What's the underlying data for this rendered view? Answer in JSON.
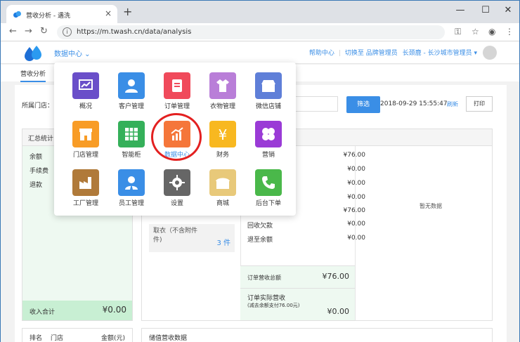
{
  "browser": {
    "tab_title": "营收分析 - 遇洗",
    "new_tab": "+",
    "close_tab": "×",
    "url": "https://m.twash.cn/data/analysis",
    "win_minimize": "—",
    "win_maximize": "☐",
    "win_close": "✕"
  },
  "topnav": {
    "section": "数据中心 ⌄",
    "help": "帮助中心",
    "switch": "切换至 品牌管理员",
    "user": "长颈鹿 - 长沙城市管理员 ▾"
  },
  "subtabs": {
    "active": "营收分析"
  },
  "filters": {
    "store_label": "所属门店：",
    "filter_button": "筛选",
    "timestamp": "2018-09-29  15:55:47",
    "refresh": "刷新",
    "print": "打印"
  },
  "summary": {
    "title": "汇总统计",
    "rows": [
      "余额",
      "手续费",
      "退款"
    ],
    "total_label": "收入合计",
    "total_value": "¥0.00"
  },
  "orders": {
    "amounts": [
      "¥76.00",
      "¥0.00",
      "¥0.00",
      "¥0.00",
      "¥76.00",
      "¥0.00",
      "¥0.00"
    ],
    "label_recovery": "回收欠款",
    "label_refund_balance": "退至余额",
    "clothes_label": "取衣（不含附件",
    "clothes_label_2": "件)",
    "clothes_count": "3 件",
    "no_data": "暂无数据",
    "total_label": "订单营收总额",
    "total_value": "¥76.00",
    "actual_label": "订单实际营收",
    "actual_sub": "(减去余额支付76.00元)",
    "actual_value": "¥0.00"
  },
  "bottom": {
    "rank": "排名",
    "store": "门店",
    "amount": "金额(元)",
    "recharge_title": "储值营收数据"
  },
  "menu": {
    "items": [
      {
        "label": "概况",
        "icon": "overview-icon",
        "color": "#6a4fc9"
      },
      {
        "label": "客户管理",
        "icon": "customer-icon",
        "color": "#3a8ee6"
      },
      {
        "label": "订单管理",
        "icon": "order-icon",
        "color": "#f04a5b"
      },
      {
        "label": "衣物管理",
        "icon": "clothes-icon",
        "color": "#b97ed8"
      },
      {
        "label": "微信店铺",
        "icon": "wechat-shop-icon",
        "color": "#5f7fd8"
      },
      {
        "label": "门店管理",
        "icon": "store-icon",
        "color": "#f89c26"
      },
      {
        "label": "智能柜",
        "icon": "locker-icon",
        "color": "#35b05a"
      },
      {
        "label": "数据中心",
        "icon": "chart-icon",
        "color": "#f5763a"
      },
      {
        "label": "财务",
        "icon": "finance-icon",
        "color": "#f8b820"
      },
      {
        "label": "营销",
        "icon": "marketing-icon",
        "color": "#9a3bd6"
      },
      {
        "label": "工厂管理",
        "icon": "factory-icon",
        "color": "#b07a3a"
      },
      {
        "label": "员工管理",
        "icon": "staff-icon",
        "color": "#3a8ee6"
      },
      {
        "label": "设置",
        "icon": "gear-icon",
        "color": "#666666"
      },
      {
        "label": "商城",
        "icon": "mall-icon",
        "color": "#e8c97a"
      },
      {
        "label": "后台下单",
        "icon": "phone-icon",
        "color": "#4ab84a"
      }
    ],
    "active_label": "数据中心"
  }
}
